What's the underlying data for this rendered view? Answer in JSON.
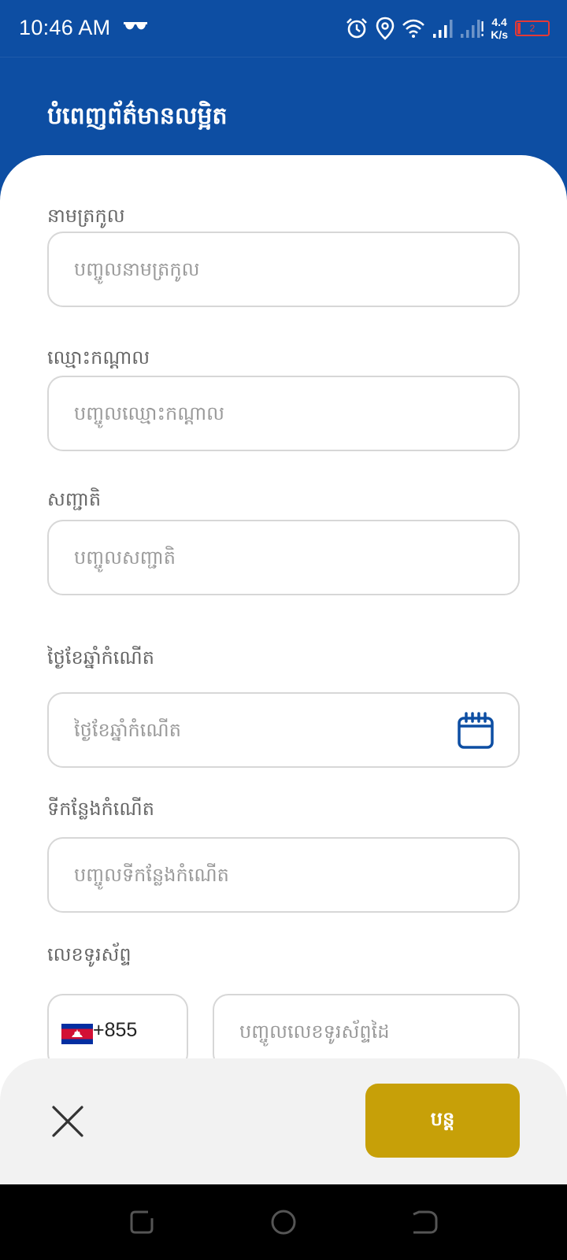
{
  "status_bar": {
    "time": "10:46 AM",
    "speed_value": "4.4",
    "speed_unit": "K/s",
    "battery_level": "2",
    "icons": [
      "glasses-icon",
      "alarm-icon",
      "location-icon",
      "wifi-icon",
      "signal-icon",
      "signal-weak-icon",
      "battery-icon"
    ]
  },
  "header": {
    "title": "បំពេញព័ត៌មានលម្អិត"
  },
  "form": {
    "last_name": {
      "label": "នាមត្រកូល",
      "placeholder": "បញ្ចូលនាមត្រកូល",
      "value": ""
    },
    "middle_name": {
      "label": "ឈ្មោះកណ្ដាល",
      "placeholder": "បញ្ចូលឈ្មោះកណ្ដាល",
      "value": ""
    },
    "nationality": {
      "label": "សញ្ជាតិ",
      "placeholder": "បញ្ចូលសញ្ជាតិ",
      "value": ""
    },
    "date_of_birth": {
      "label": "ថ្ងៃខែឆ្នាំកំណើត",
      "placeholder": "ថ្ងៃខែឆ្នាំកំណើត",
      "value": "",
      "icon": "calendar-icon"
    },
    "place_of_birth": {
      "label": "ទីកន្លែងកំណើត",
      "placeholder": "បញ្ចូលទីកន្លែងកំណើត",
      "value": ""
    },
    "phone": {
      "label": "លេខទូរស័ព្ទ",
      "country_code": "+855",
      "flag": "cambodia-flag-icon",
      "placeholder": "បញ្ចូលលេខទូរស័ព្ទដៃ",
      "value": ""
    }
  },
  "actions": {
    "close_icon": "close-icon",
    "continue_label": "បន្ត"
  },
  "colors": {
    "primary": "#0d4ea3",
    "accent": "#c7a008",
    "panel": "#f2f2f2",
    "border": "#d7d7d7"
  }
}
